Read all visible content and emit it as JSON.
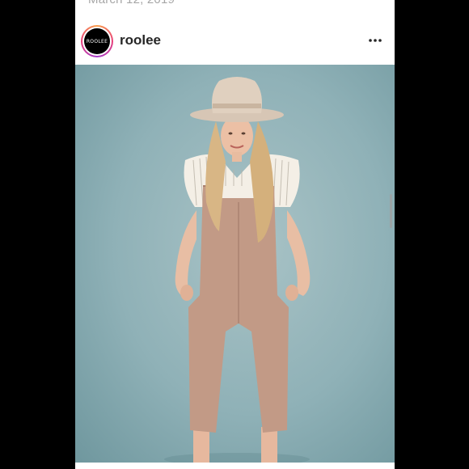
{
  "post": {
    "date": "March 12, 2019",
    "username": "roolee",
    "avatar_text": "ROOLEE",
    "more_icon": "more-horizontal-icon"
  },
  "colors": {
    "background_frame": "#000000",
    "card": "#ffffff",
    "username_text": "#262626",
    "date_text": "#a6a6a6",
    "photo_backdrop": "#8fb1b7",
    "overalls": "#c29a86"
  }
}
